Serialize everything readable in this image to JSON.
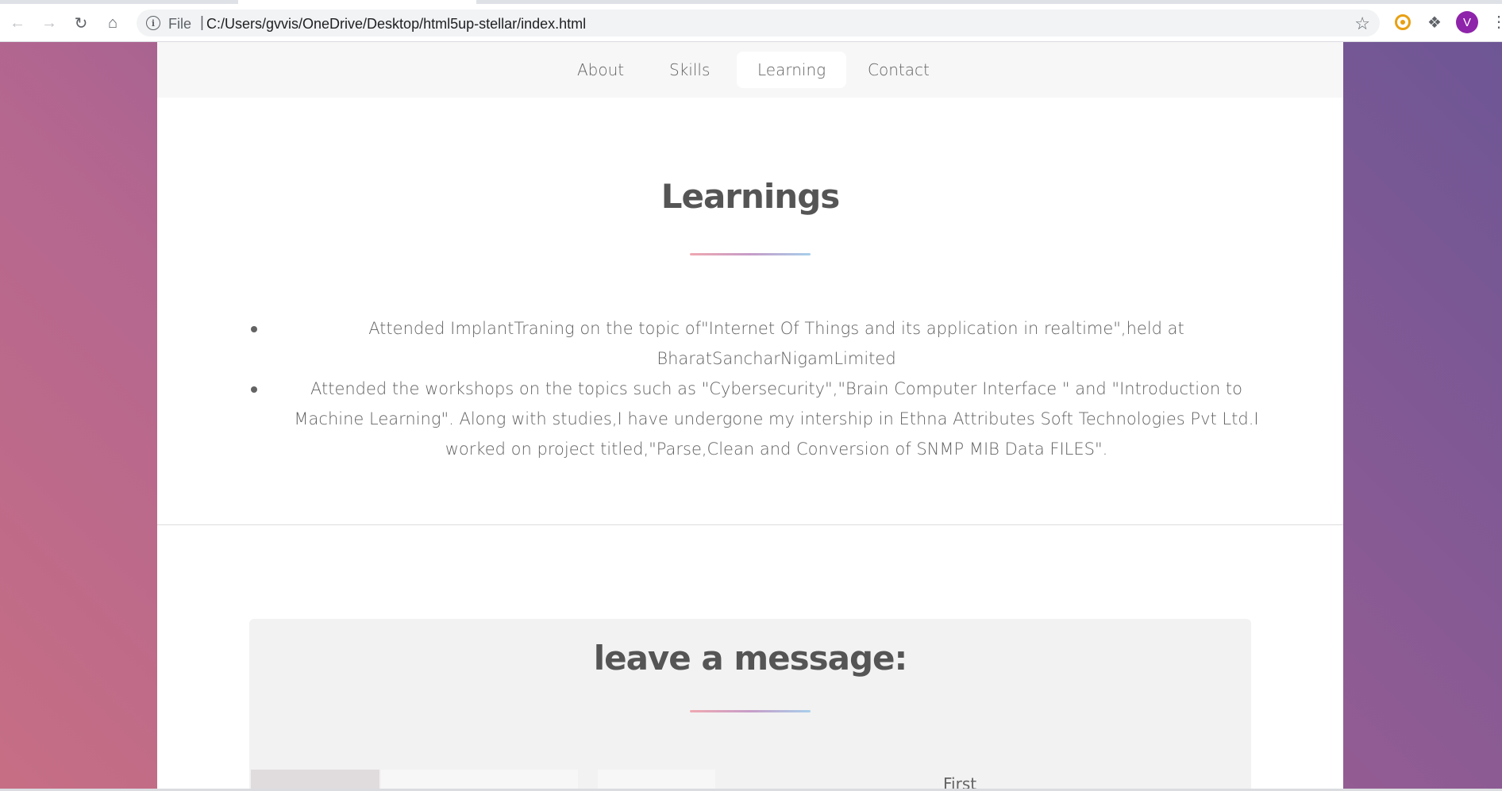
{
  "browser": {
    "back_icon": "arrow-left-icon",
    "forward_icon": "arrow-right-icon",
    "reload_icon": "reload-icon",
    "home_icon": "home-icon",
    "scheme_label": "File",
    "url": "C:/Users/gvvis/OneDrive/Desktop/html5up-stellar/index.html",
    "avatar_letter": "V"
  },
  "nav": {
    "items": [
      {
        "label": "About"
      },
      {
        "label": "Skills"
      },
      {
        "label": "Learning",
        "active": true
      },
      {
        "label": "Contact"
      }
    ]
  },
  "learning": {
    "title": "Learnings",
    "items": [
      "Attended ImplantTraning on the topic of\"Internet Of Things and its application in realtime\",held at BharatSancharNigamLimited",
      "Attended the workshops on the topics such as \"Cybersecurity\",\"Brain Computer Interface \" and \"Introduction to Machine Learning\". Along with studies,I have undergone my intership in Ethna Attributes Soft Technologies Pvt Ltd.I worked on project titled,\"Parse,Clean and Conversion of SNMP MIB Data FILES\"."
    ]
  },
  "contact": {
    "title": "leave a message:",
    "partial_field_label": "First"
  },
  "colors": {
    "gradient_start": "#c66e84",
    "gradient_end": "#6e5695",
    "accent_line_left": "#efa8b0",
    "accent_line_right": "#a7cfeb"
  }
}
